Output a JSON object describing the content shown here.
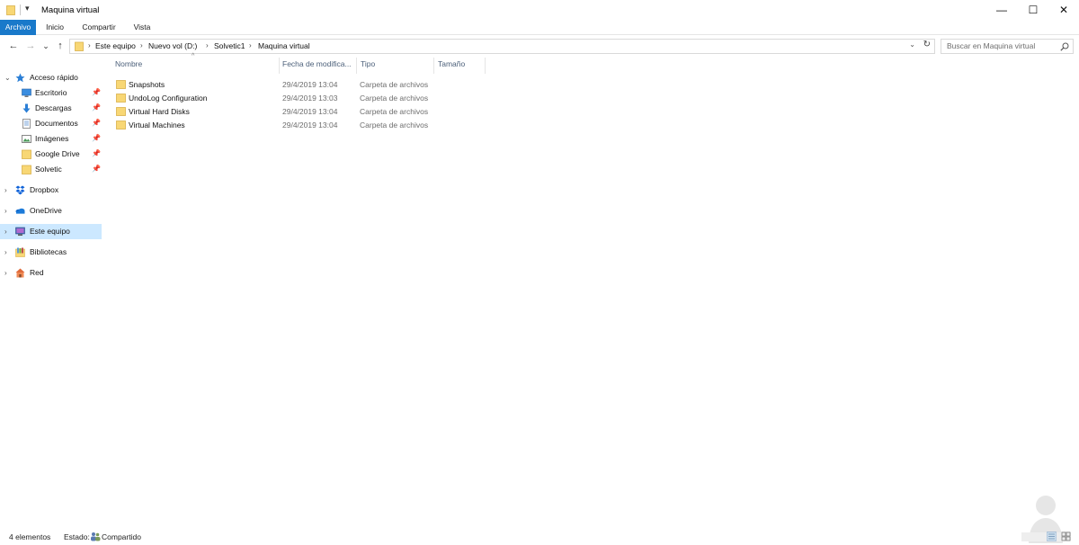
{
  "window": {
    "title": "Maquina virtual",
    "quick_access_glyph": "▾",
    "buttons": {
      "minimize": "—",
      "maximize": "☐",
      "close": "✕"
    }
  },
  "ribbon": {
    "tabs": [
      "Archivo",
      "Inicio",
      "Compartir",
      "Vista"
    ],
    "active_color": "#1979ca"
  },
  "nav": {
    "back": "←",
    "forward": "→",
    "recent": "⌄",
    "up": "↑",
    "breadcrumb": [
      "Este equipo",
      "Nuevo vol (D:)",
      "Solvetic1",
      "Maquina virtual"
    ],
    "chevron": "›",
    "dropdown": "⌄",
    "refresh": "↻",
    "search_placeholder": "Buscar en Maquina virtual"
  },
  "sidebar": {
    "items": [
      {
        "label": "Acceso rápido",
        "icon": "star-icon",
        "expander": "⌄",
        "pin": ""
      },
      {
        "label": "Escritorio",
        "icon": "desktop-icon",
        "expander": "",
        "pin": "📌"
      },
      {
        "label": "Descargas",
        "icon": "download-icon",
        "expander": "",
        "pin": "📌"
      },
      {
        "label": "Documentos",
        "icon": "documents-icon",
        "expander": "",
        "pin": "📌"
      },
      {
        "label": "Imágenes",
        "icon": "pictures-icon",
        "expander": "",
        "pin": "📌"
      },
      {
        "label": "Google Drive",
        "icon": "folder-icon",
        "expander": "",
        "pin": "📌"
      },
      {
        "label": "Solvetic",
        "icon": "folder-icon",
        "expander": "",
        "pin": "📌"
      },
      {
        "label": "Dropbox",
        "icon": "dropbox-icon",
        "expander": "›",
        "pin": ""
      },
      {
        "label": "OneDrive",
        "icon": "onedrive-icon",
        "expander": "›",
        "pin": ""
      },
      {
        "label": "Este equipo",
        "icon": "computer-icon",
        "expander": "›",
        "pin": ""
      },
      {
        "label": "Bibliotecas",
        "icon": "libraries-icon",
        "expander": "›",
        "pin": ""
      },
      {
        "label": "Red",
        "icon": "network-icon",
        "expander": "›",
        "pin": ""
      }
    ],
    "selected": "Este equipo",
    "selected_color": "#cce8ff"
  },
  "columns": [
    "Nombre",
    "Fecha de modifica...",
    "Tipo",
    "Tamaño"
  ],
  "sort_indicator": "^",
  "files": [
    {
      "name": "Snapshots",
      "date": "29/4/2019 13:04",
      "type": "Carpeta de archivos"
    },
    {
      "name": "UndoLog Configuration",
      "date": "29/4/2019 13:03",
      "type": "Carpeta de archivos"
    },
    {
      "name": "Virtual Hard Disks",
      "date": "29/4/2019 13:04",
      "type": "Carpeta de archivos"
    },
    {
      "name": "Virtual Machines",
      "date": "29/4/2019 13:04",
      "type": "Carpeta de archivos"
    }
  ],
  "status": {
    "count": "4 elementos",
    "state_label": "Estado:",
    "state_value": "Compartido"
  },
  "colors": {
    "folder": "#f8d775",
    "folder_dark": "#e0b84a"
  }
}
